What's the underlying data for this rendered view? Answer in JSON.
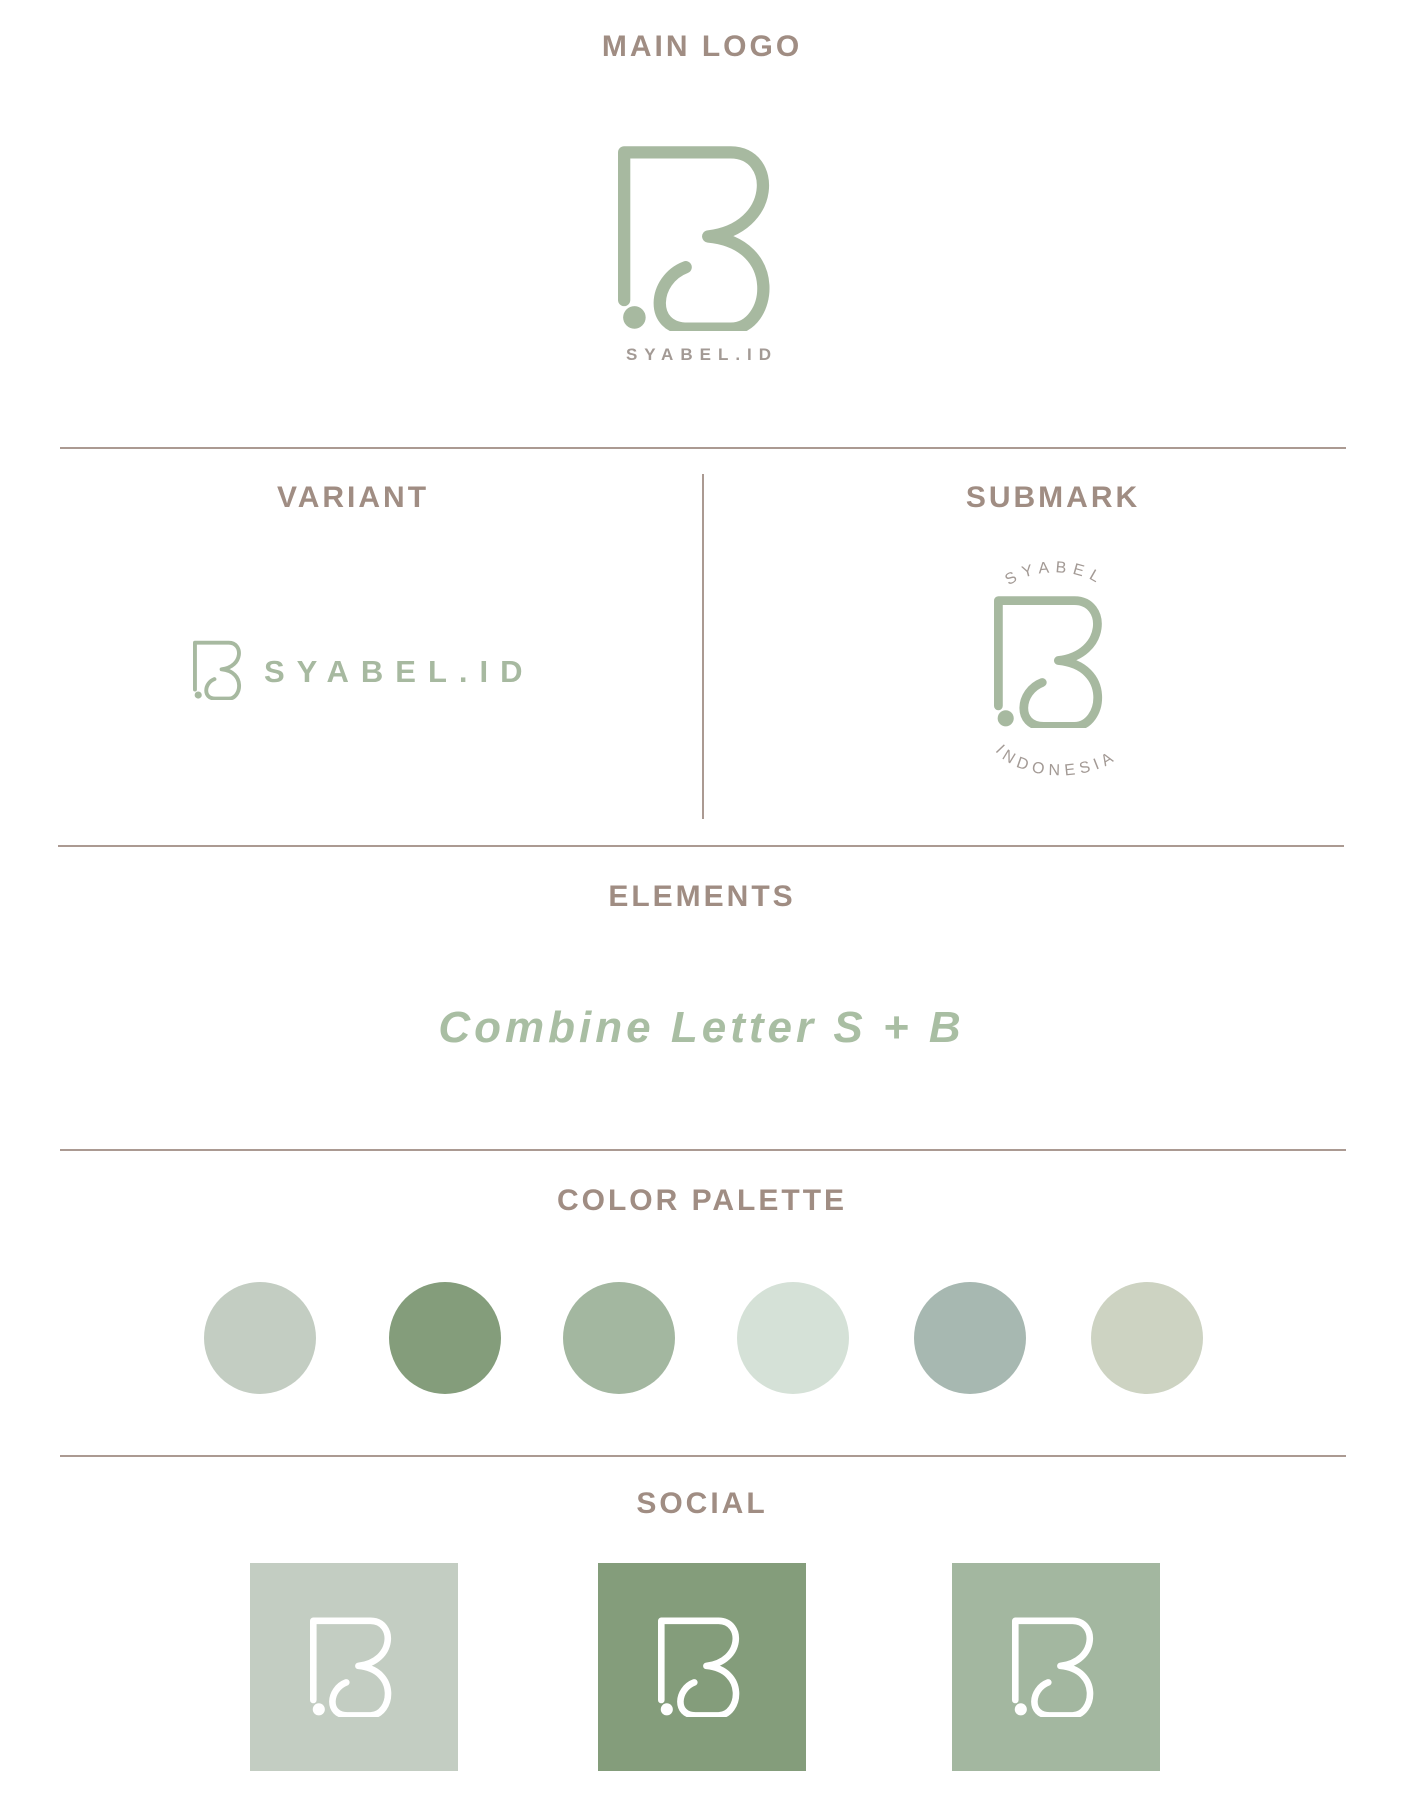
{
  "sections": {
    "main_logo": {
      "heading": "MAIN LOGO",
      "tagline": "SYABEL.ID"
    },
    "variant": {
      "heading": "VARIANT",
      "wordmark": "SYABEL.ID"
    },
    "submark": {
      "heading": "SUBMARK",
      "top_arc_text": "SYABEL",
      "bottom_arc_text": "INDONESIA"
    },
    "elements": {
      "heading": "ELEMENTS",
      "text": "Combine Letter S + B"
    },
    "color_palette": {
      "heading": "COLOR PALETTE",
      "colors": [
        "#c3cdc2",
        "#849d7b",
        "#a3b7a0",
        "#d5e1d7",
        "#a7b8b1",
        "#cdd3c2"
      ]
    },
    "social": {
      "heading": "SOCIAL",
      "tiles": [
        {
          "bg": "#c3cdc2",
          "icon": "sb-logo-icon"
        },
        {
          "bg": "#849d7b",
          "icon": "sb-logo-icon"
        },
        {
          "bg": "#a3b7a0",
          "icon": "sb-logo-icon"
        }
      ]
    }
  },
  "colors": {
    "heading": "#a08d83",
    "rule": "#ab9a92",
    "logo_green": "#a7b9a0",
    "icon_white": "#ffffff"
  }
}
